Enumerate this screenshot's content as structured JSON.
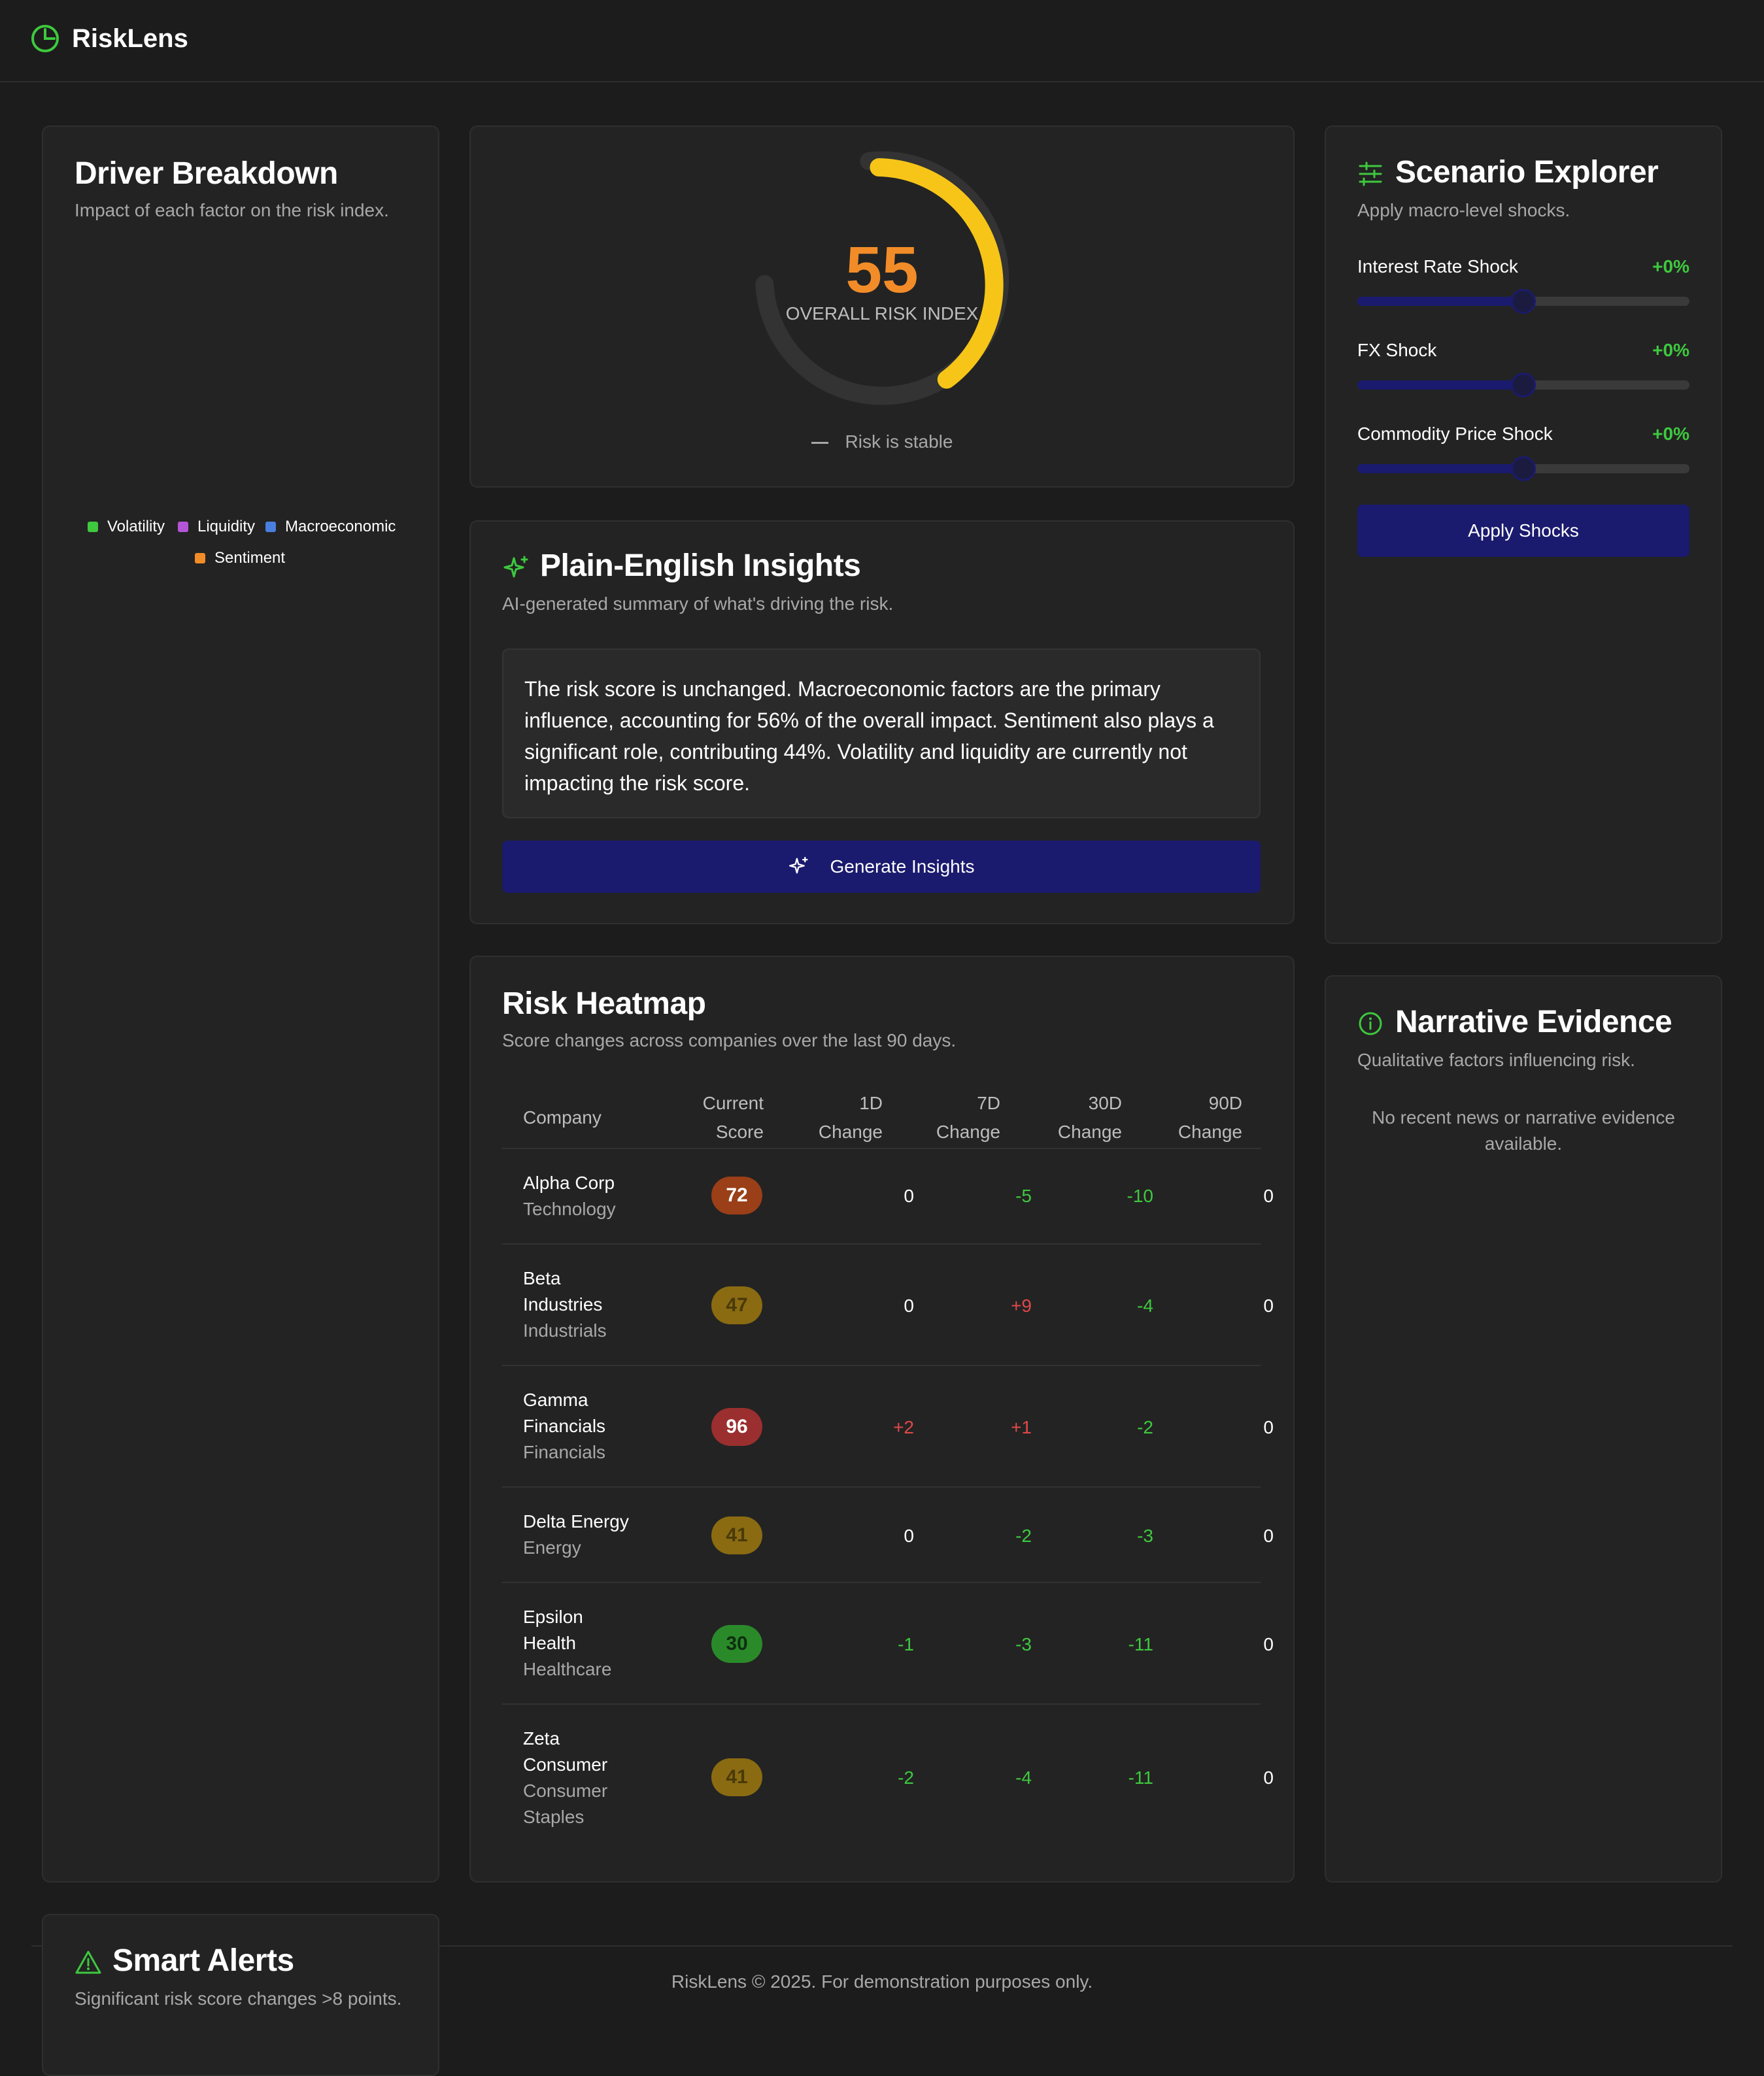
{
  "app": {
    "name": "RiskLens"
  },
  "colors": {
    "accent": "#3ec93e",
    "button": "#1a1a6e",
    "gauge": "#f6c518",
    "score": "#f28c28",
    "up": "#e04848",
    "down": "#3ec93e"
  },
  "driver": {
    "title": "Driver Breakdown",
    "subtitle": "Impact of each factor on the risk index.",
    "legend": [
      {
        "label": "Volatility",
        "color": "#3ec93e"
      },
      {
        "label": "Liquidity",
        "color": "#b455d8"
      },
      {
        "label": "Macroeconomic",
        "color": "#4a7fe0"
      },
      {
        "label": "Sentiment",
        "color": "#f28c28"
      }
    ]
  },
  "gauge": {
    "value": "55",
    "label": "OVERALL RISK INDEX",
    "status": "Risk is stable",
    "fraction": 0.55
  },
  "insights": {
    "title": "Plain-English Insights",
    "subtitle": "AI-generated summary of what's driving the risk.",
    "text": "The risk score is unchanged. Macroeconomic factors are the primary influence, accounting for 56% of the overall impact. Sentiment also plays a significant role, contributing 44%. Volatility and liquidity are currently not impacting the risk score.",
    "button": "Generate Insights"
  },
  "heatmap": {
    "title": "Risk Heatmap",
    "subtitle": "Score changes across companies over the last 90 days.",
    "headers": {
      "company": "Company",
      "score": [
        "Current",
        "Score"
      ],
      "d1": [
        "1D",
        "Change"
      ],
      "d7": [
        "7D",
        "Change"
      ],
      "d30": [
        "30D",
        "Change"
      ],
      "d90": [
        "90D",
        "Change"
      ]
    },
    "rows": [
      {
        "name": "Alpha Corp",
        "sector": "Technology",
        "score": "72",
        "d1": "0",
        "d7": "-5",
        "d30": "-10",
        "d90": "0"
      },
      {
        "name": "Beta Industries",
        "sector": "Industrials",
        "score": "47",
        "d1": "0",
        "d7": "+9",
        "d30": "-4",
        "d90": "0"
      },
      {
        "name": "Gamma Financials",
        "sector": "Financials",
        "score": "96",
        "d1": "+2",
        "d7": "+1",
        "d30": "-2",
        "d90": "0"
      },
      {
        "name": "Delta Energy",
        "sector": "Energy",
        "score": "41",
        "d1": "0",
        "d7": "-2",
        "d30": "-3",
        "d90": "0"
      },
      {
        "name": "Epsilon Health",
        "sector": "Healthcare",
        "score": "30",
        "d1": "-1",
        "d7": "-3",
        "d30": "-11",
        "d90": "0"
      },
      {
        "name": "Zeta Consumer",
        "sector": "Consumer Staples",
        "score": "41",
        "d1": "-2",
        "d7": "-4",
        "d30": "-11",
        "d90": "0"
      }
    ]
  },
  "scenario": {
    "title": "Scenario Explorer",
    "subtitle": "Apply macro-level shocks.",
    "sliders": [
      {
        "label": "Interest Rate Shock",
        "value": "+0%",
        "position": 0.5
      },
      {
        "label": "FX Shock",
        "value": "+0%",
        "position": 0.5
      },
      {
        "label": "Commodity Price Shock",
        "value": "+0%",
        "position": 0.5
      }
    ],
    "button": "Apply Shocks"
  },
  "narrative": {
    "title": "Narrative Evidence",
    "subtitle": "Qualitative factors influencing risk.",
    "empty": "No recent news or narrative evidence available."
  },
  "alerts": {
    "title": "Smart Alerts",
    "subtitle": "Significant risk score changes >8 points."
  },
  "footer": "RiskLens © 2025. For demonstration purposes only."
}
